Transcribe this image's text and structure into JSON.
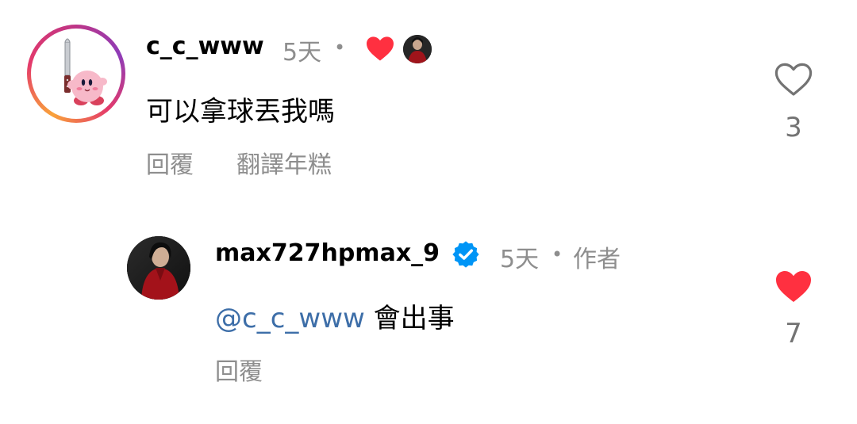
{
  "comment": {
    "username": "c_c_www",
    "time": "5天",
    "dot": "•",
    "text": "可以拿球丟我嗎",
    "reply_label": "回覆",
    "translate_label": "翻譯年糕",
    "like_count": "3",
    "liked_by_author": true
  },
  "reply": {
    "username": "max727hpmax_9",
    "time": "5天",
    "dot": "•",
    "author_label": "作者",
    "mention": "@c_c_www",
    "text": "會出事",
    "reply_label": "回覆",
    "like_count": "7",
    "liked": true,
    "verified": true
  },
  "colors": {
    "like_red": "#ff3040",
    "mention_blue": "#3d6ea8",
    "verified_blue": "#0095f6",
    "muted_gray": "#8e8e8e"
  },
  "icons": {
    "heart_outline": "heart-outline-icon",
    "heart_filled": "heart-filled-icon",
    "verified": "verified-badge-icon"
  }
}
